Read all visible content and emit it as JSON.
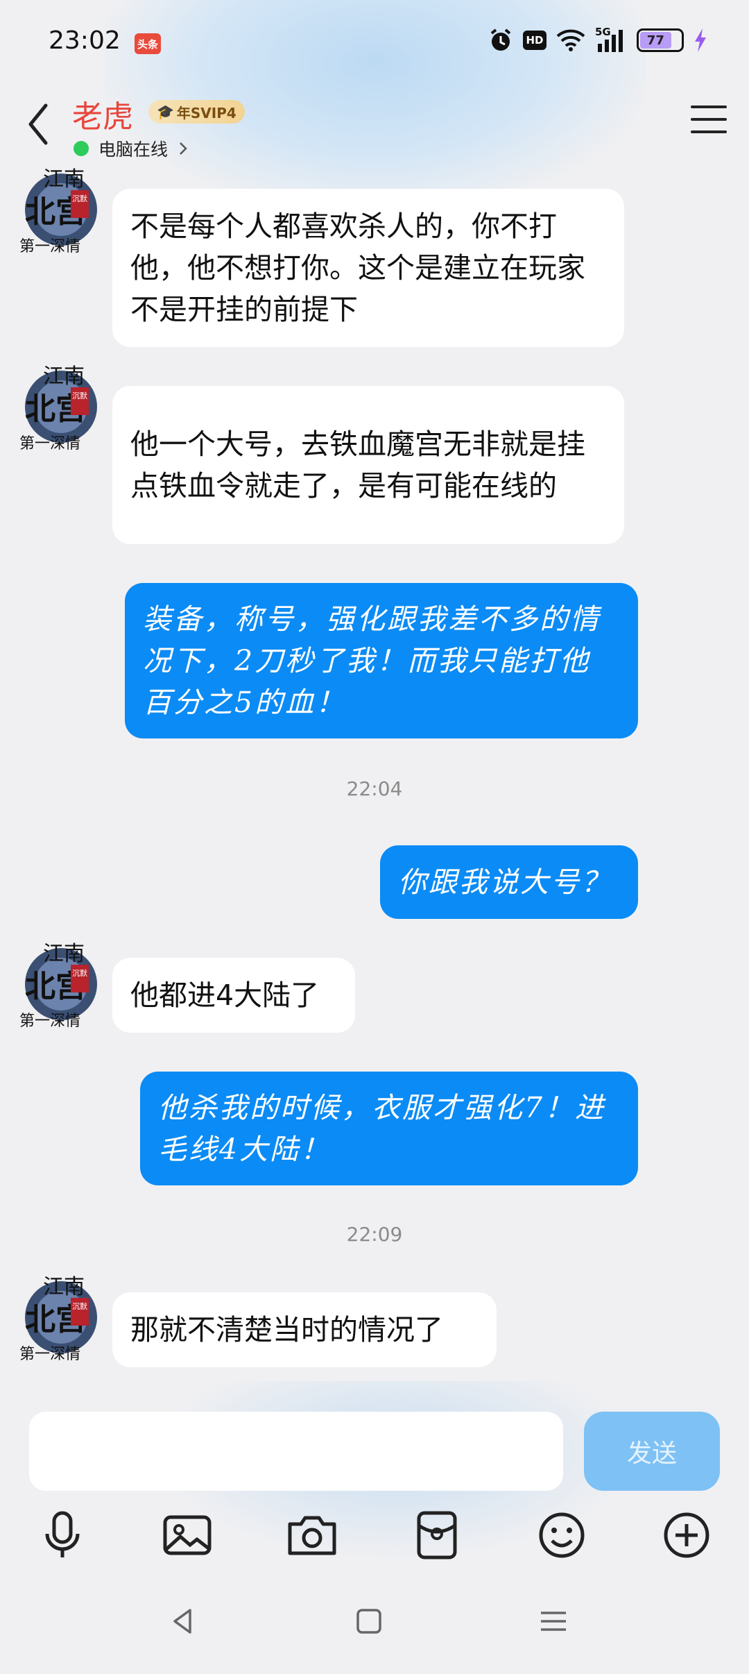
{
  "status_bar": {
    "time": "23:02",
    "notif_badge": "头条",
    "hd": "HD",
    "network": "5G",
    "battery": "77"
  },
  "header": {
    "contact_name": "老虎",
    "vip_badge": "年SVIP4",
    "presence": "电脑在线"
  },
  "messages": [
    {
      "side": "in",
      "text": "不是每个人都喜欢杀人的，你不打他，他不想打你。这个是建立在玩家不是开挂的前提下"
    },
    {
      "side": "in",
      "text": "他一个大号，去铁血魔宫无非就是挂点铁血令就走了，是有可能在线的"
    },
    {
      "side": "out",
      "text": "装备，称号，强化跟我差不多的情况下，2刀秒了我！而我只能打他百分之5的血！"
    },
    {
      "side": "time",
      "text": "22:04"
    },
    {
      "side": "out",
      "text": "你跟我说大号？"
    },
    {
      "side": "in",
      "text": "他都进4大陆了"
    },
    {
      "side": "out",
      "text": "他杀我的时候，衣服才强化7！进毛线4大陆！"
    },
    {
      "side": "time",
      "text": "22:09"
    },
    {
      "side": "in",
      "text": "那就不清楚当时的情况了"
    }
  ],
  "avatar_text": {
    "line1": "江南",
    "line2": "北宫",
    "line3": "第一深情",
    "tag": "沉默"
  },
  "input": {
    "placeholder": "",
    "send_label": "发送"
  },
  "colors": {
    "outgoing_bubble": "#0b8bf5",
    "incoming_bubble": "#ffffff",
    "name": "#e8463c",
    "send_button": "#7ec1f5"
  }
}
